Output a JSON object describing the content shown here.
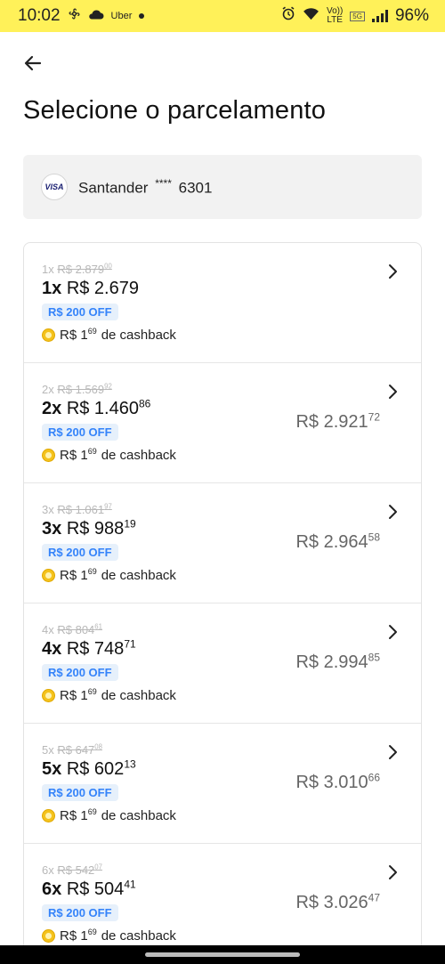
{
  "status_bar": {
    "time": "10:02",
    "left_label": "Uber",
    "volte_top": "Vo))",
    "volte_bottom": "LTE",
    "network": "5G",
    "battery": "96%"
  },
  "header": {
    "title": "Selecione o parcelamento"
  },
  "card": {
    "brand": "VISA",
    "bank": "Santander",
    "mask": "****",
    "last4": "6301"
  },
  "installments": [
    {
      "old_count": "1x",
      "old_price_main": "R$ 2.879",
      "old_price_cents": "00",
      "count": "1x",
      "price_main": "R$ 2.679",
      "price_cents": "",
      "badge": "R$ 200 OFF",
      "cashback_int": "R$ 1",
      "cashback_cents": "69",
      "cashback_text": "de cashback",
      "total_main": "",
      "total_cents": ""
    },
    {
      "old_count": "2x",
      "old_price_main": "R$ 1.569",
      "old_price_cents": "92",
      "count": "2x",
      "price_main": "R$ 1.460",
      "price_cents": "86",
      "badge": "R$ 200 OFF",
      "cashback_int": "R$ 1",
      "cashback_cents": "69",
      "cashback_text": "de cashback",
      "total_main": "R$ 2.921",
      "total_cents": "72"
    },
    {
      "old_count": "3x",
      "old_price_main": "R$ 1.061",
      "old_price_cents": "97",
      "count": "3x",
      "price_main": "R$ 988",
      "price_cents": "19",
      "badge": "R$ 200 OFF",
      "cashback_int": "R$ 1",
      "cashback_cents": "69",
      "cashback_text": "de cashback",
      "total_main": "R$ 2.964",
      "total_cents": "58"
    },
    {
      "old_count": "4x",
      "old_price_main": "R$ 804",
      "old_price_cents": "61",
      "count": "4x",
      "price_main": "R$ 748",
      "price_cents": "71",
      "badge": "R$ 200 OFF",
      "cashback_int": "R$ 1",
      "cashback_cents": "69",
      "cashback_text": "de cashback",
      "total_main": "R$ 2.994",
      "total_cents": "85"
    },
    {
      "old_count": "5x",
      "old_price_main": "R$ 647",
      "old_price_cents": "08",
      "count": "5x",
      "price_main": "R$ 602",
      "price_cents": "13",
      "badge": "R$ 200 OFF",
      "cashback_int": "R$ 1",
      "cashback_cents": "69",
      "cashback_text": "de cashback",
      "total_main": "R$ 3.010",
      "total_cents": "66"
    },
    {
      "old_count": "6x",
      "old_price_main": "R$ 542",
      "old_price_cents": "07",
      "count": "6x",
      "price_main": "R$ 504",
      "price_cents": "41",
      "badge": "R$ 200 OFF",
      "cashback_int": "R$ 1",
      "cashback_cents": "69",
      "cashback_text": "de cashback",
      "total_main": "R$ 3.026",
      "total_cents": "47"
    }
  ],
  "colors": {
    "status_bar_bg": "#fff159",
    "badge_text": "#3483fa",
    "badge_bg": "#e6f0fb",
    "coin": "#f4c21c"
  }
}
